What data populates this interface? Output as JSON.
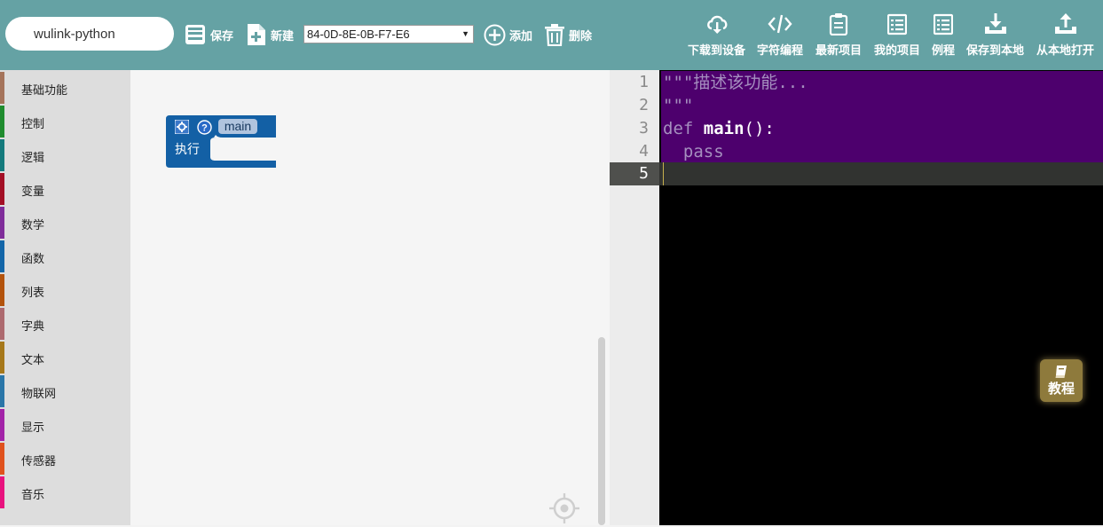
{
  "toolbar": {
    "project_name": "wulink-python",
    "save_label": "保存",
    "new_label": "新建",
    "device_id": "84-0D-8E-0B-F7-E6",
    "add_label": "添加",
    "delete_label": "删除",
    "right_actions": [
      {
        "label": "下载到设备",
        "icon": "cloud-download-icon"
      },
      {
        "label": "字符编程",
        "icon": "code-icon"
      },
      {
        "label": "最新项目",
        "icon": "clipboard-icon"
      },
      {
        "label": "我的项目",
        "icon": "list-icon"
      },
      {
        "label": "例程",
        "icon": "list-icon"
      },
      {
        "label": "保存到本地",
        "icon": "download-tray-icon"
      },
      {
        "label": "从本地打开",
        "icon": "upload-tray-icon"
      }
    ]
  },
  "sidebar": {
    "categories": [
      {
        "label": "基础功能",
        "color": "#a5745b"
      },
      {
        "label": "控制",
        "color": "#1f8c2e"
      },
      {
        "label": "逻辑",
        "color": "#147a7c"
      },
      {
        "label": "变量",
        "color": "#a30f25"
      },
      {
        "label": "数学",
        "color": "#7f2d9a"
      },
      {
        "label": "函数",
        "color": "#1366a8"
      },
      {
        "label": "列表",
        "color": "#b3530c"
      },
      {
        "label": "字典",
        "color": "#ad6a6f"
      },
      {
        "label": "文本",
        "color": "#a6781a"
      },
      {
        "label": "物联网",
        "color": "#2a76a8"
      },
      {
        "label": "显示",
        "color": "#a223a8"
      },
      {
        "label": "传感器",
        "color": "#e0521d"
      },
      {
        "label": "音乐",
        "color": "#e8127e"
      }
    ]
  },
  "workspace": {
    "block": {
      "function_name": "main",
      "body_label": "执行",
      "color": "#1360a5"
    }
  },
  "editor": {
    "line_numbers": [
      "1",
      "2",
      "3",
      "4",
      "5"
    ],
    "active_line": "5",
    "lines": {
      "l1": "\"\"\"描述该功能...",
      "l2": "\"\"\"",
      "l3_kw": "def ",
      "l3_name": "main",
      "l3_rest": "():",
      "l4": "  pass"
    }
  },
  "tutorial": {
    "label": "教程"
  },
  "colors": {
    "toolbar": "#65a2a4",
    "sidebar": "#dddddd",
    "selection": "#4d006d",
    "tutorial": "#8e7a3c"
  }
}
